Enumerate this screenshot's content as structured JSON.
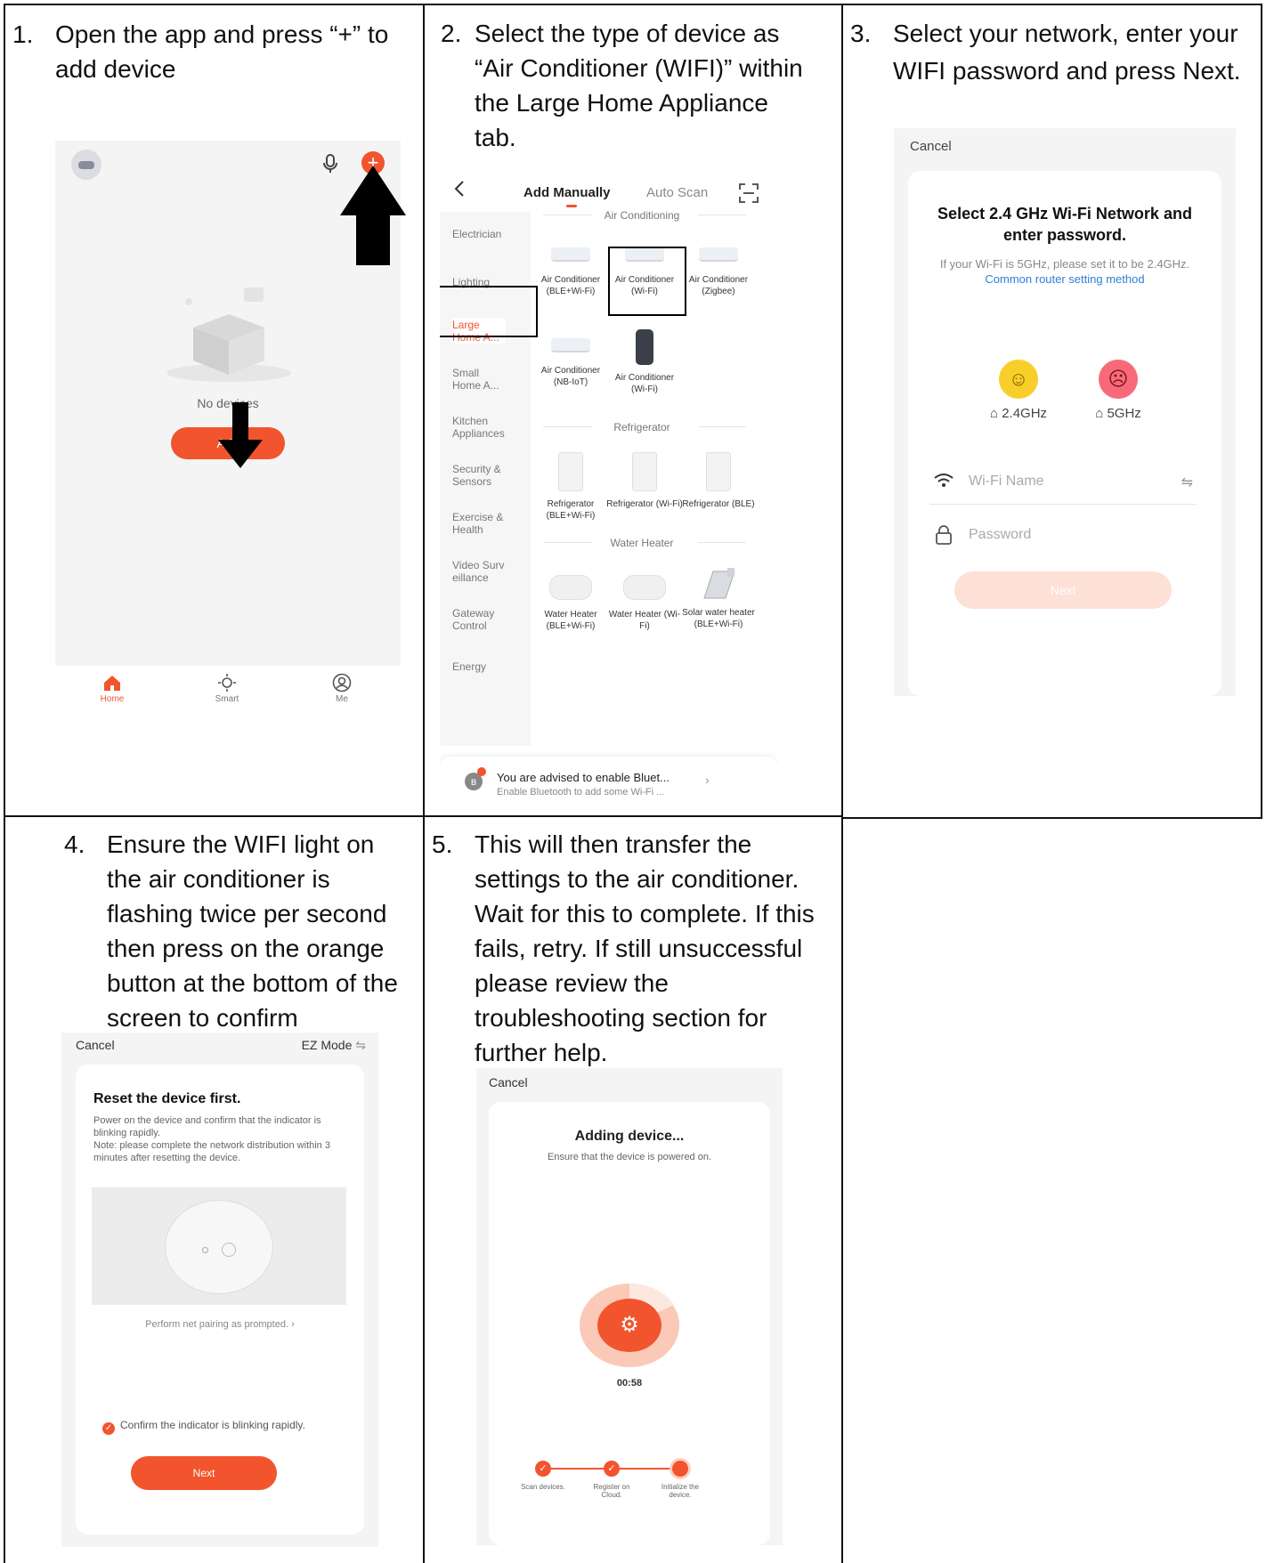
{
  "steps": {
    "s1": {
      "number": "1.",
      "text": "Open the app and press “+” to add device"
    },
    "s2": {
      "number": "2.",
      "text": "Select the type of device as “Air Conditioner (WIFI)” within the Large Home Appliance tab."
    },
    "s3": {
      "number": "3.",
      "text": "Select your network, enter your WIFI password and press Next."
    },
    "s4": {
      "number": "4.",
      "text": "Ensure the WIFI light on the air conditioner is flashing twice per second then press on the orange button at the bottom of the screen to confirm"
    },
    "s5": {
      "number": "5.",
      "text": "This will then transfer the settings to the air conditioner. Wait for this to complete. If this fails, retry. If still unsuccessful please review the troubleshooting section for further help."
    }
  },
  "screen1": {
    "empty_text": "No devices",
    "add_button": "Add",
    "tabs": [
      {
        "label": "Home",
        "icon": "home-icon"
      },
      {
        "label": "Smart",
        "icon": "sun-icon"
      },
      {
        "label": "Me",
        "icon": "profile-icon"
      }
    ]
  },
  "screen2": {
    "tab_manual": "Add Manually",
    "tab_auto": "Auto Scan",
    "categories": [
      "Electrician",
      "Lighting",
      "Large Home A...",
      "Small Home A...",
      "Kitchen Appliances",
      "Security & Sensors",
      "Exercise & Health",
      "Video Surv eillance",
      "Gateway Control",
      "Energy"
    ],
    "sections": [
      {
        "title": "Air Conditioning",
        "items": [
          "Air Conditioner (BLE+Wi-Fi)",
          "Air Conditioner (Wi-Fi)",
          "Air Conditioner (Zigbee)",
          "Air Conditioner (NB-IoT)",
          "Air Conditioner (Wi-Fi)"
        ]
      },
      {
        "title": "Refrigerator",
        "items": [
          "Refrigerator (BLE+Wi-Fi)",
          "Refrigerator (Wi-Fi)",
          "Refrigerator (BLE)"
        ]
      },
      {
        "title": "Water Heater",
        "items": [
          "Water Heater (BLE+Wi-Fi)",
          "Water Heater (Wi-Fi)",
          "Solar water heater (BLE+Wi-Fi)"
        ]
      }
    ],
    "banner_title": "You are advised to enable Bluet...",
    "banner_sub": "Enable Bluetooth to add some Wi-Fi ..."
  },
  "screen3": {
    "cancel": "Cancel",
    "title": "Select 2.4 GHz Wi-Fi Network and enter password.",
    "note": "If your Wi-Fi is 5GHz, please set it to be 2.4GHz.",
    "link": "Common router setting method",
    "band_good": "2.4GHz",
    "band_bad": "5GHz",
    "wifi_placeholder": "Wi-Fi Name",
    "password_placeholder": "Password",
    "next": "Next"
  },
  "screen4": {
    "cancel": "Cancel",
    "mode": "EZ Mode",
    "title": "Reset the device first.",
    "body": "Power on the device and confirm that the indicator is blinking rapidly.\nNote: please complete the network distribution within 3 minutes after resetting the device.",
    "prompt": "Perform net pairing as prompted.",
    "confirm": "Confirm the indicator is blinking rapidly.",
    "next": "Next"
  },
  "screen5": {
    "cancel": "Cancel",
    "title": "Adding device...",
    "sub": "Ensure that the device is powered on.",
    "timer": "00:58",
    "progress_steps": [
      "Scan devices.",
      "Register on Cloud.",
      "Initialize the device."
    ]
  }
}
